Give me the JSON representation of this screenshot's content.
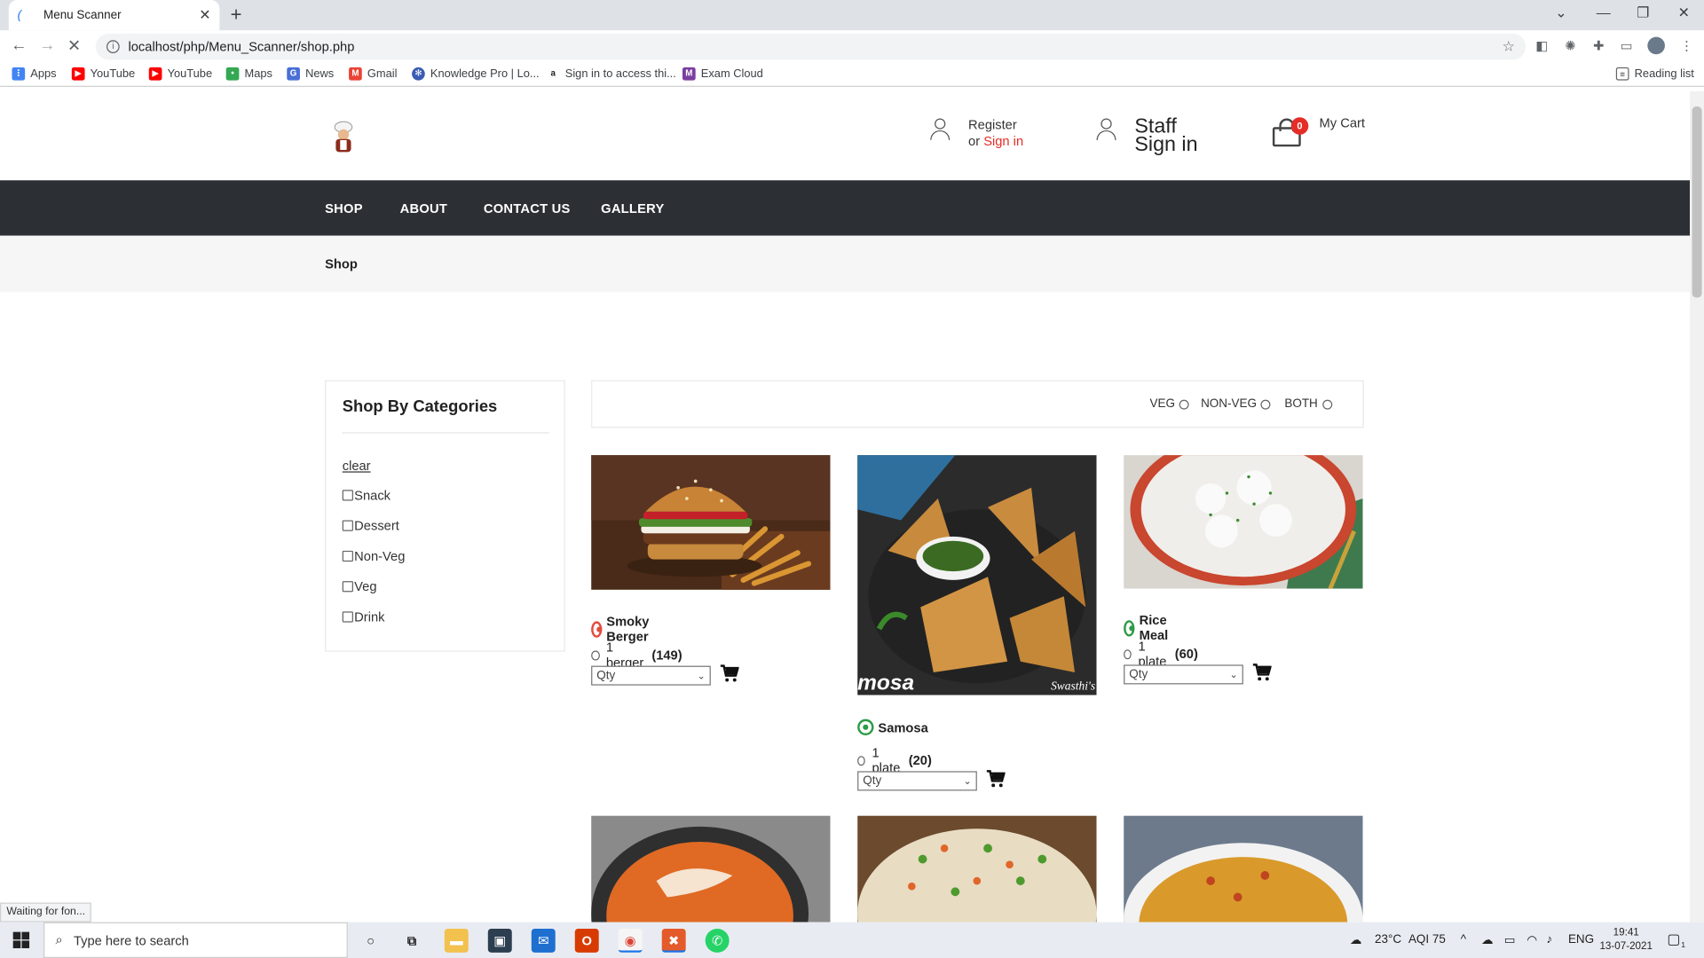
{
  "browser": {
    "tab_title": "Menu Scanner",
    "url": "localhost/php/Menu_Scanner/shop.php",
    "bookmarks": [
      "Apps",
      "YouTube",
      "YouTube",
      "Maps",
      "News",
      "Gmail",
      "Knowledge Pro | Lo...",
      "Sign in to access thi...",
      "Exam Cloud"
    ],
    "reading_list": "Reading list",
    "status": "Waiting for fon..."
  },
  "header": {
    "register": "Register",
    "or": "or",
    "sign_in": "Sign in",
    "staff_line1": "Staff",
    "staff_line2": "Sign in",
    "cart_count": "0",
    "my_cart": "My Cart"
  },
  "nav": {
    "items": [
      "SHOP",
      "ABOUT",
      "CONTACT US",
      "GALLERY"
    ]
  },
  "breadcrumb": "Shop",
  "sidebar": {
    "title": "Shop By Categories",
    "clear": "clear",
    "categories": [
      "Snack",
      "Dessert",
      "Non-Veg",
      "Veg",
      "Drink"
    ]
  },
  "filters": [
    "VEG",
    "NON-VEG",
    "BOTH"
  ],
  "products": [
    {
      "name": "Smoky Berger",
      "portion": "1 berger",
      "price": "(149)",
      "qty_placeholder": "Qty",
      "type": "non-veg"
    },
    {
      "name": "Samosa",
      "portion": "1 plate",
      "price": "(20)",
      "qty_placeholder": "Qty",
      "type": "veg",
      "image_text": "mosa",
      "image_brand": "Swasthi's"
    },
    {
      "name": "Rice Meal",
      "portion": "1 plate",
      "price": "(60)",
      "qty_placeholder": "Qty",
      "type": "veg"
    }
  ],
  "colors": {
    "accent_red": "#e52d27",
    "nav_bg": "#2c3035",
    "veg_green": "#2e9b47",
    "nonveg_red": "#e54b3c"
  },
  "taskbar": {
    "search_placeholder": "Type here to search",
    "weather": "23°C",
    "aqi": "AQI 75",
    "lang": "ENG",
    "time": "19:41",
    "date": "13-07-2021",
    "notifications": "1"
  }
}
